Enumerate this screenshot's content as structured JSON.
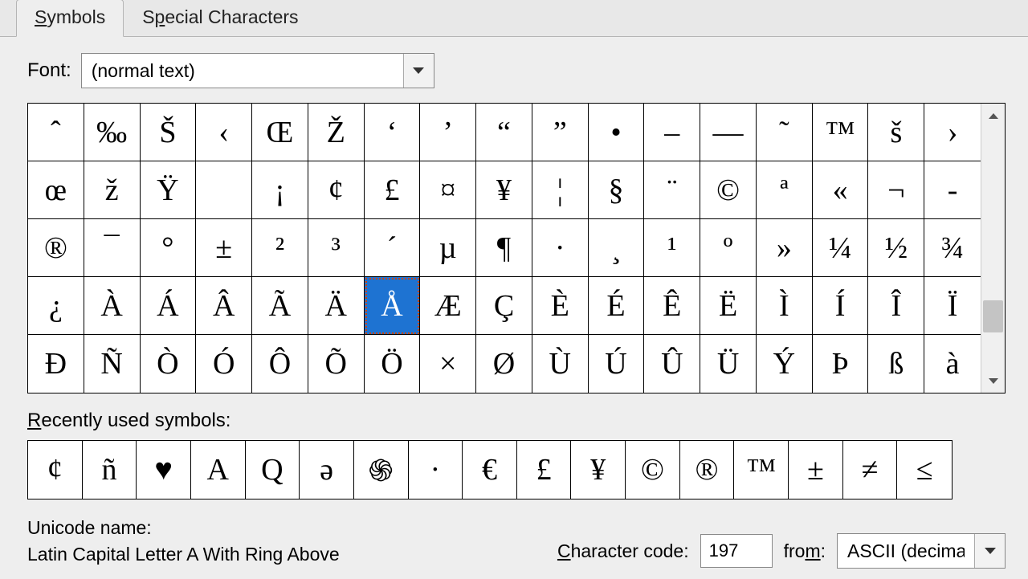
{
  "tabs": {
    "symbols": "Symbols",
    "special": "Special Characters"
  },
  "font": {
    "label": "Font:",
    "value": "(normal text)"
  },
  "grid": {
    "rows": [
      [
        "ˆ",
        "‰",
        "Š",
        "‹",
        "Œ",
        "Ž",
        "‘",
        "’",
        "“",
        "”",
        "•",
        "–",
        "—",
        "˜",
        "™",
        "š",
        "›"
      ],
      [
        "œ",
        "ž",
        "Ÿ",
        " ",
        "¡",
        "¢",
        "£",
        "¤",
        "¥",
        "¦",
        "§",
        "¨",
        "©",
        "ª",
        "«",
        "¬",
        "­-"
      ],
      [
        "®",
        "¯",
        "°",
        "±",
        "²",
        "³",
        "´",
        "µ",
        "¶",
        "·",
        "¸",
        "¹",
        "º",
        "»",
        "¼",
        "½",
        "¾"
      ],
      [
        "¿",
        "À",
        "Á",
        "Â",
        "Ã",
        "Ä",
        "Å",
        "Æ",
        "Ç",
        "È",
        "É",
        "Ê",
        "Ë",
        "Ì",
        "Í",
        "Î",
        "Ï"
      ],
      [
        "Ð",
        "Ñ",
        "Ò",
        "Ó",
        "Ô",
        "Õ",
        "Ö",
        "×",
        "Ø",
        "Ù",
        "Ú",
        "Û",
        "Ü",
        "Ý",
        "Þ",
        "ß",
        "à"
      ]
    ],
    "selected_row": 3,
    "selected_col": 6
  },
  "recent": {
    "label": "Recently used symbols:",
    "items": [
      "¢",
      "ñ",
      "♥",
      "A",
      "Q",
      "ə",
      "֍",
      "·",
      "€",
      "£",
      "¥",
      "©",
      "®",
      "™",
      "±",
      "≠",
      "≤"
    ]
  },
  "unicode": {
    "label": "Unicode name:",
    "name": "Latin Capital Letter A With Ring Above"
  },
  "charcode": {
    "label": "Character code:",
    "value": "197"
  },
  "from": {
    "label": "from:",
    "value": "ASCII (decimal)"
  }
}
